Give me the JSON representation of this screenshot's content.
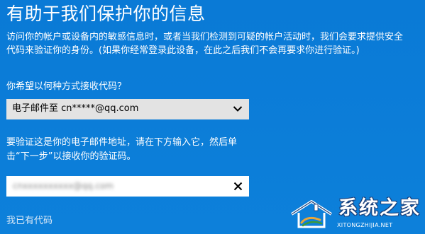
{
  "title": "有助于我们保护你的信息",
  "description": {
    "line1": "访问你的帐户或设备内的敏感信息时，或者当我们检测到可疑的帐户活动时，我们会要求提供安全",
    "line2": "代码来验证你的身份。(如果你经常登录此设备，在此之后我们不会再要求你进行验证。)"
  },
  "question": "你希望以何种方式接收代码？",
  "method_select": {
    "value": "电子邮件至 cn*****@qq.com",
    "icon": "chevron-down-icon"
  },
  "instruction": {
    "line1": "要验证这是你的电子邮件地址，请在下方输入它，然后单",
    "line2": "击“下一步”以接收你的验证码。"
  },
  "email_input": {
    "value": "cnxxxxxxxxxx@qq.com",
    "clear_icon": "close-icon"
  },
  "have_code_link": "我已有代码",
  "watermark": {
    "text": "系统之家",
    "url": "XITONGZHIJIA.NET"
  },
  "colors": {
    "background": "#0f7ed8",
    "select_bg": "#e3e3e3",
    "input_bg": "#ffffff"
  }
}
